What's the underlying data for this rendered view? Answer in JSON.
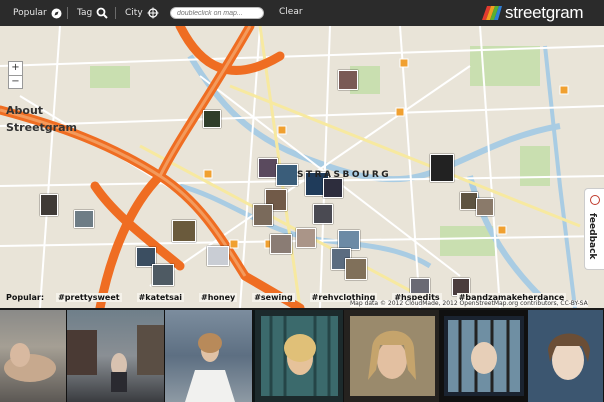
{
  "nav": {
    "popular_label": "Popular",
    "tag_label": "Tag",
    "city_label": "City",
    "search_placeholder": "doubleclick on map...",
    "clear_label": "Clear"
  },
  "brand": {
    "name": "streetgram",
    "colors": [
      "#e23b2e",
      "#f0a020",
      "#5ab030",
      "#2e7fd6"
    ]
  },
  "map": {
    "zoom_in": "+",
    "zoom_out": "−",
    "about_line1": "About",
    "about_line2": "Streetgram",
    "city_name": "STRASBOURG",
    "feedback_label": "feedback",
    "attribution": "Map data © 2012 CloudMade, 2012 OpenStreetMap.org contributors, CC-BY-SA",
    "colors": {
      "land": "#e9e4d8",
      "motorway": "#ef6d22",
      "water": "#a9cce3",
      "park": "#c9dfb0"
    }
  },
  "popular": {
    "label": "Popular:",
    "tags": [
      "#prettysweet",
      "#katetsai",
      "#honey",
      "#sewing",
      "#rehvclothing",
      "#hspedits",
      "#bandzamakeherdance"
    ]
  },
  "photos": [
    "photo-1",
    "photo-2",
    "photo-3",
    "photo-4",
    "photo-5",
    "photo-6",
    "photo-7"
  ]
}
